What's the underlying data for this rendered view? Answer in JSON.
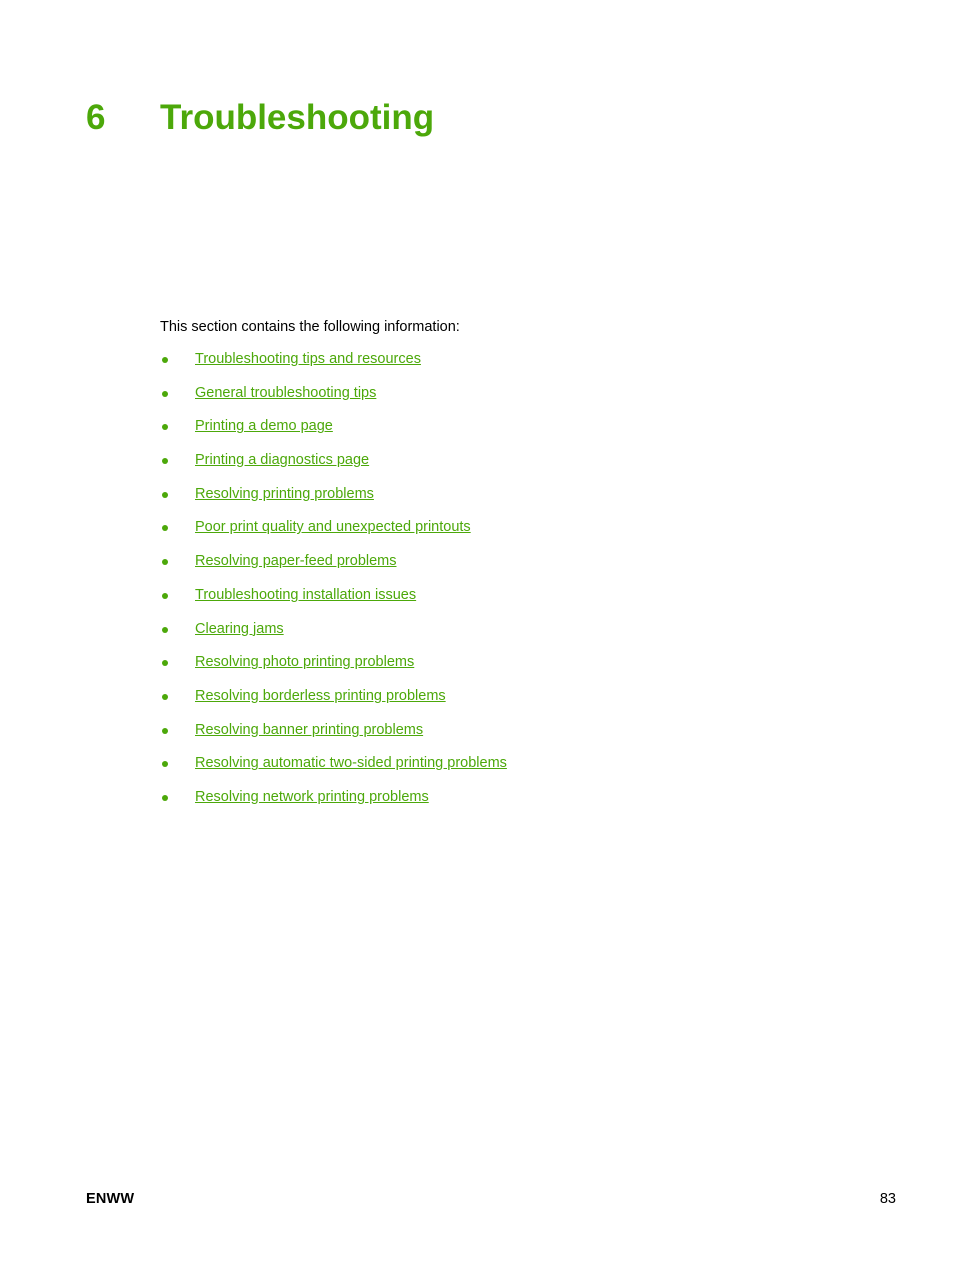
{
  "theme": {
    "accent_color": "#4CA80A",
    "text_color": "#000000",
    "background_color": "#FFFFFF"
  },
  "chapter": {
    "number": "6",
    "title": "Troubleshooting"
  },
  "intro": {
    "text": "This section contains the following information:"
  },
  "toc": {
    "items": [
      {
        "label": "Troubleshooting tips and resources"
      },
      {
        "label": "General troubleshooting tips"
      },
      {
        "label": "Printing a demo page"
      },
      {
        "label": "Printing a diagnostics page"
      },
      {
        "label": "Resolving printing problems"
      },
      {
        "label": "Poor print quality and unexpected printouts"
      },
      {
        "label": "Resolving paper-feed problems"
      },
      {
        "label": "Troubleshooting installation issues"
      },
      {
        "label": "Clearing jams"
      },
      {
        "label": "Resolving photo printing problems"
      },
      {
        "label": "Resolving borderless printing problems"
      },
      {
        "label": "Resolving banner printing problems"
      },
      {
        "label": "Resolving automatic two-sided printing problems"
      },
      {
        "label": "Resolving network printing problems"
      }
    ]
  },
  "footer": {
    "left": "ENWW",
    "page_number": "83"
  }
}
